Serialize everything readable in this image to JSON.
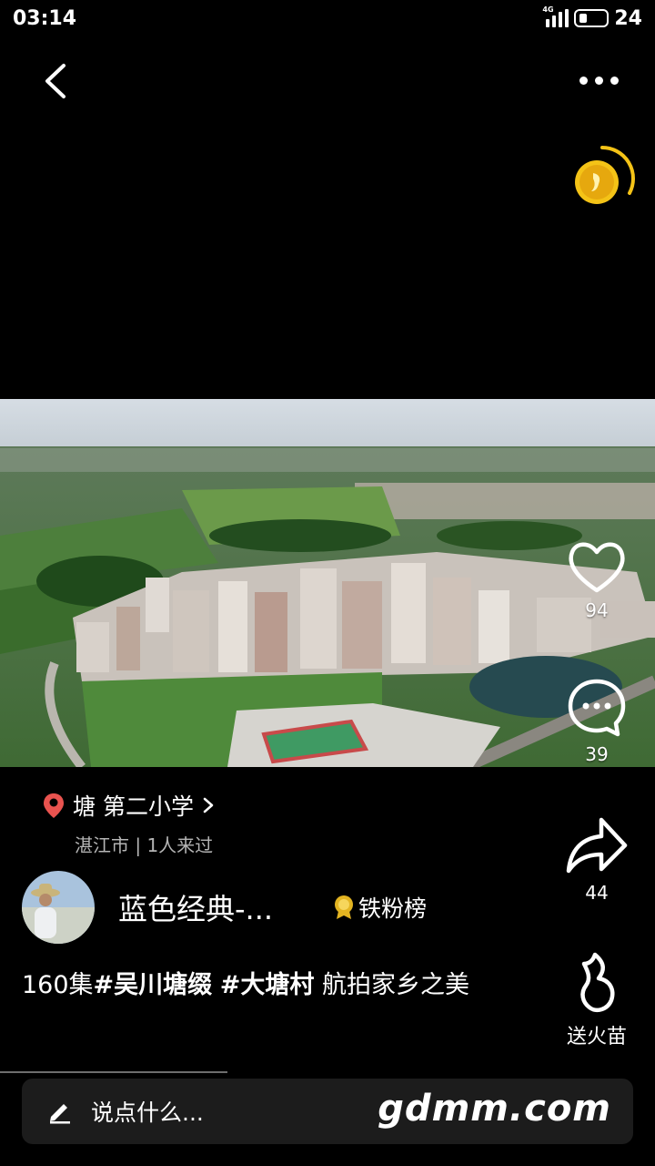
{
  "status_bar": {
    "time": "03:14",
    "network": "4G",
    "battery": "24"
  },
  "actions": {
    "like_count": "94",
    "comment_count": "39",
    "share_count": "44",
    "gift_label": "送火苗"
  },
  "location": {
    "name": "塘 第二小学",
    "sub": "湛江市 | 1人来过"
  },
  "author": {
    "name": "蓝色经典-...",
    "fan_badge": "铁粉榜"
  },
  "caption": {
    "prefix": "160集",
    "tag1": "#吴川塘缀",
    "tag2": "#大塘村",
    "suffix": " 航拍家乡之美"
  },
  "comment_bar": {
    "placeholder": "说点什么..."
  },
  "watermark": "gdmm.com",
  "colors": {
    "background": "#000000",
    "location_pin": "#e9534f",
    "coin": "#f4c317"
  },
  "icons": [
    "back-icon",
    "more-icon",
    "coin-icon",
    "heart-icon",
    "comment-icon",
    "share-icon",
    "flame-icon",
    "location-pin-icon",
    "edit-icon",
    "medal-icon"
  ]
}
